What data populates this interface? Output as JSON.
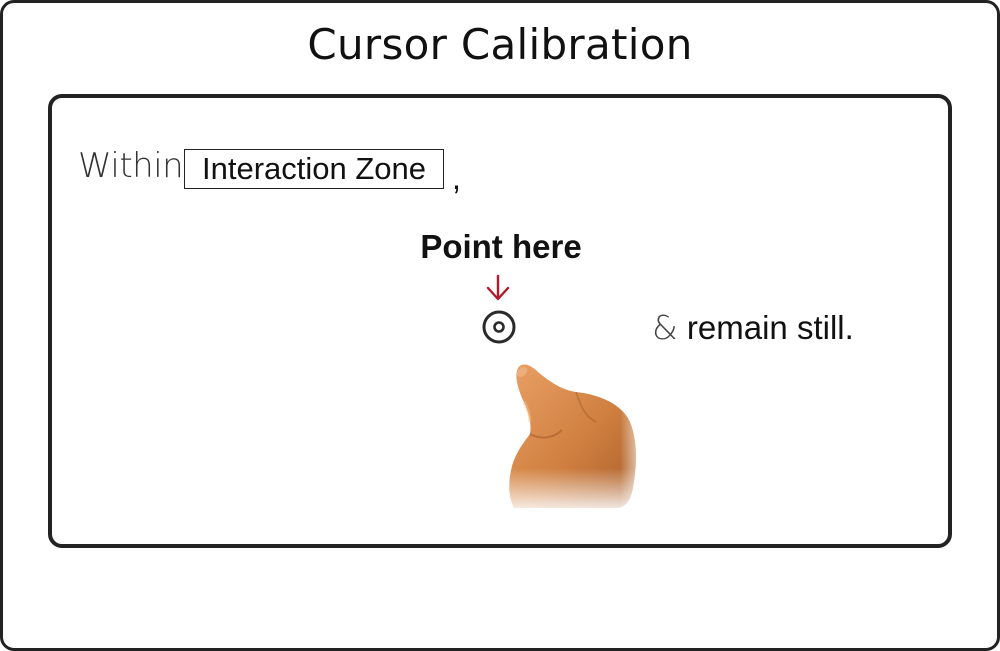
{
  "title": "Cursor Calibration",
  "instruction": {
    "prefix": "Within",
    "zone_label": "Interaction Zone",
    "comma": ",",
    "point_label": "Point here",
    "amp": "&",
    "suffix": "remain still."
  },
  "icons": {
    "arrow": "down-arrow-icon",
    "target": "target-icon",
    "hand": "pointing-hand-image"
  },
  "colors": {
    "arrow": "#b3192b",
    "border": "#222222",
    "text": "#111111",
    "skin": "#d9874a"
  }
}
